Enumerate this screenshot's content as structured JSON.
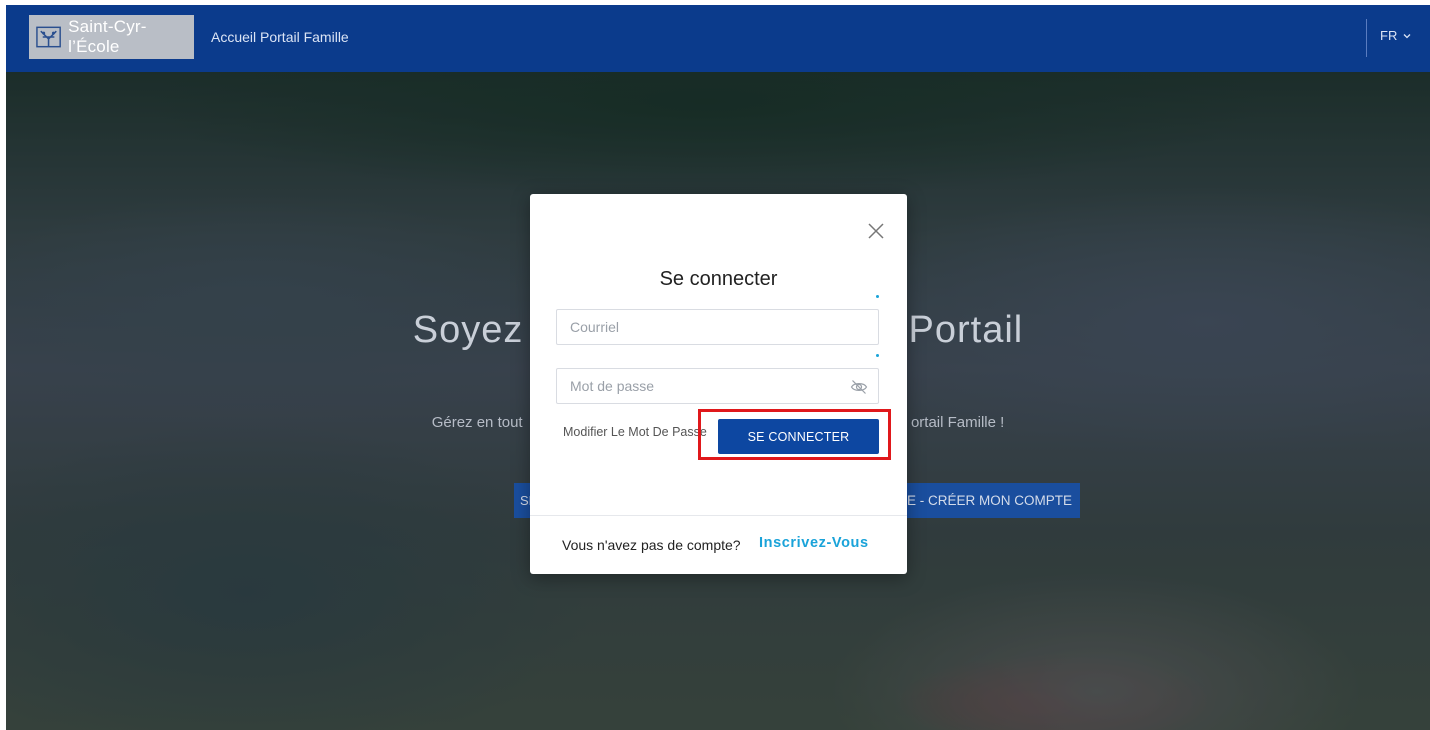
{
  "header": {
    "logo_text": "Saint-Cyr-l’École",
    "nav_link": "Accueil Portail Famille",
    "language": "FR"
  },
  "hero": {
    "title_left": "Soyez",
    "title_right": "Portail",
    "subtitle_left": "Gérez en tout",
    "subtitle_right": "ortail Famille !",
    "button_left_label": "SE",
    "button_right_label": "E - CRÉER MON COMPTE"
  },
  "login_modal": {
    "title": "Se connecter",
    "email_placeholder": "Courriel",
    "password_placeholder": "Mot de passe",
    "forgot_password": "Modifier Le Mot De Passe",
    "login_button": "SE CONNECTER",
    "no_account_text": "Vous n'avez pas de compte?",
    "signup_link": "Inscrivez-Vous"
  },
  "colors": {
    "header_bg": "#0b3b8c",
    "primary_button": "#0d47a1",
    "link_accent": "#1aa3d9",
    "highlight_box": "#e0181b"
  },
  "icons": {
    "close": "close-icon",
    "password_visibility": "eye-off-icon",
    "language_chevron": "chevron-down-icon",
    "city_crest": "crest-icon"
  }
}
